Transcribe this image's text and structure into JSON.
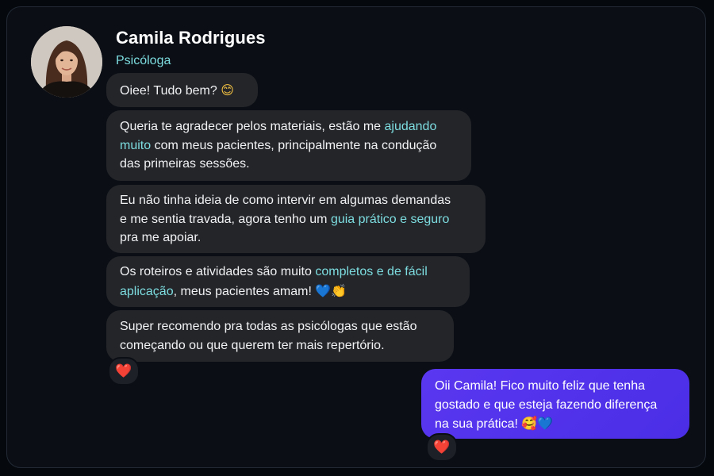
{
  "contact": {
    "name": "Camila Rodrigues",
    "role": "Psicóloga"
  },
  "messages": [
    {
      "from": "contact",
      "t1": "Oiee! Tudo bem? ",
      "e1": "😊"
    },
    {
      "from": "contact",
      "l1a": "Queria te agradecer pelos materiais, estão me ",
      "l1b": "ajudando",
      "l2a": "muito",
      "l2b": " com meus pacientes, principalmente na condução",
      "l3": "das primeiras sessões."
    },
    {
      "from": "contact",
      "l1": "Eu não tinha ideia de como intervir em algumas demandas",
      "l2a": "e me sentia travada, agora tenho um ",
      "l2b": "guia prático e seguro",
      "l3": "pra me apoiar."
    },
    {
      "from": "contact",
      "l1a": "Os roteiros e atividades são muito ",
      "l1b": "completos e de fácil",
      "l2a": "aplicação",
      "l2b": ", meus pacientes amam! ",
      "e1": "💙",
      "e2": "👏"
    },
    {
      "from": "contact",
      "l1": "Super recomendo pra todas as psicólogas que estão",
      "l2": "começando ou que querem ter mais repertório.",
      "reaction": "❤️"
    },
    {
      "from": "me",
      "l1": "Oii Camila! Fico muito feliz que tenha",
      "l2": "gostado e que esteja fazendo diferença",
      "l3": "na sua prática! ",
      "e1": "🥰",
      "e2": "💙",
      "reaction": "❤️"
    }
  ],
  "colors": {
    "background": "#0b0f15",
    "incoming_bubble": "#232529",
    "outgoing_bubble": "#5233ec",
    "highlight": "#7ddde0",
    "role": "#7ddde0"
  }
}
